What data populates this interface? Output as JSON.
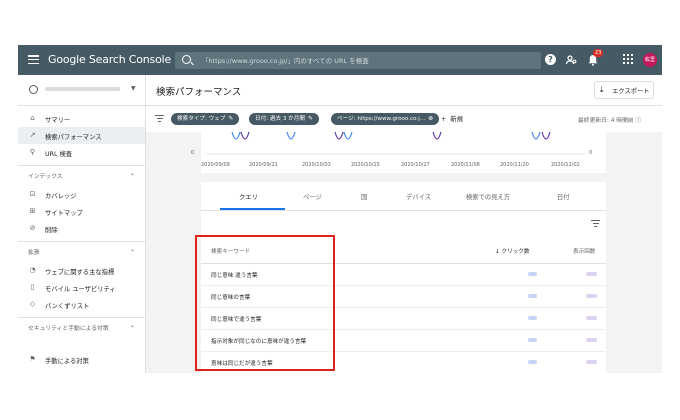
{
  "topbar": {
    "brand": "Google Search Console",
    "search_placeholder": "「https://www.grooo.co.jp/」内のすべての URL を検査",
    "help_icon": "?",
    "notification_count": "23",
    "avatar_label": "紘里"
  },
  "sidebar": {
    "nav_top": [
      {
        "icon": "home-icon",
        "glyph": "⌂",
        "label": "サマリー"
      },
      {
        "icon": "trending-icon",
        "glyph": "↗",
        "label": "検索パフォーマンス"
      },
      {
        "icon": "search-icon",
        "glyph": "⚲",
        "label": "URL 検査"
      }
    ],
    "section_index": {
      "label": "インデックス",
      "chevron": "⌃"
    },
    "nav_index": [
      {
        "icon": "coverage-icon",
        "glyph": "⊡",
        "label": "カバレッジ"
      },
      {
        "icon": "sitemap-icon",
        "glyph": "⊞",
        "label": "サイトマップ"
      },
      {
        "icon": "removal-icon",
        "glyph": "⊘",
        "label": "削除"
      }
    ],
    "section_enhance": {
      "label": "拡張",
      "chevron": "⌃"
    },
    "nav_enhance": [
      {
        "icon": "gauge-icon",
        "glyph": "◔",
        "label": "ウェブに関する主な指標"
      },
      {
        "icon": "mobile-icon",
        "glyph": "▯",
        "label": "モバイル ユーザビリティ"
      },
      {
        "icon": "breadcrumb-icon",
        "glyph": "◇",
        "label": "パンくずリスト"
      }
    ],
    "section_security": {
      "label": "セキュリティと手動による対策",
      "chevron": "⌃"
    },
    "nav_security": [
      {
        "icon": "flag-icon",
        "glyph": "⚑",
        "label": "手動による対策"
      }
    ]
  },
  "header": {
    "title": "検索パフォーマンス",
    "export_label": "エクスポート"
  },
  "filters": {
    "chips": [
      {
        "label": "検索タイプ: ウェブ",
        "edit": "✎"
      },
      {
        "label": "日付: 過去 3 か月間",
        "edit": "✎"
      },
      {
        "label": "ページ: https://www.grooo.co.j...",
        "edit": "⊗"
      }
    ],
    "new_label": "新規",
    "updated": "最終更新日: 4 時間前"
  },
  "chart_data": {
    "type": "line",
    "x": [
      "2020/09/09",
      "2020/09/21",
      "2020/10/03",
      "2020/10/15",
      "2020/10/27",
      "2020/11/08",
      "2020/11/20",
      "2020/12/02"
    ],
    "y_left_label": "0",
    "y_right_label": "0",
    "colors": {
      "clicks": "#4285f4",
      "impressions": "#5e35b1"
    }
  },
  "tabs": [
    "クエリ",
    "ページ",
    "国",
    "デバイス",
    "検索での見え方",
    "日付"
  ],
  "table": {
    "headers": {
      "query": "検索キーワード",
      "clicks": "クリック数",
      "impressions": "表示回数"
    },
    "sort_icon": "↓",
    "rows": [
      {
        "query": "同じ意味 違う言葉"
      },
      {
        "query": "同じ意味の言葉"
      },
      {
        "query": "同じ意味で違う言葉"
      },
      {
        "query": "指示対象が同じなのに意味が違う言葉"
      },
      {
        "query": "意味は同じだが違う言葉"
      }
    ]
  }
}
